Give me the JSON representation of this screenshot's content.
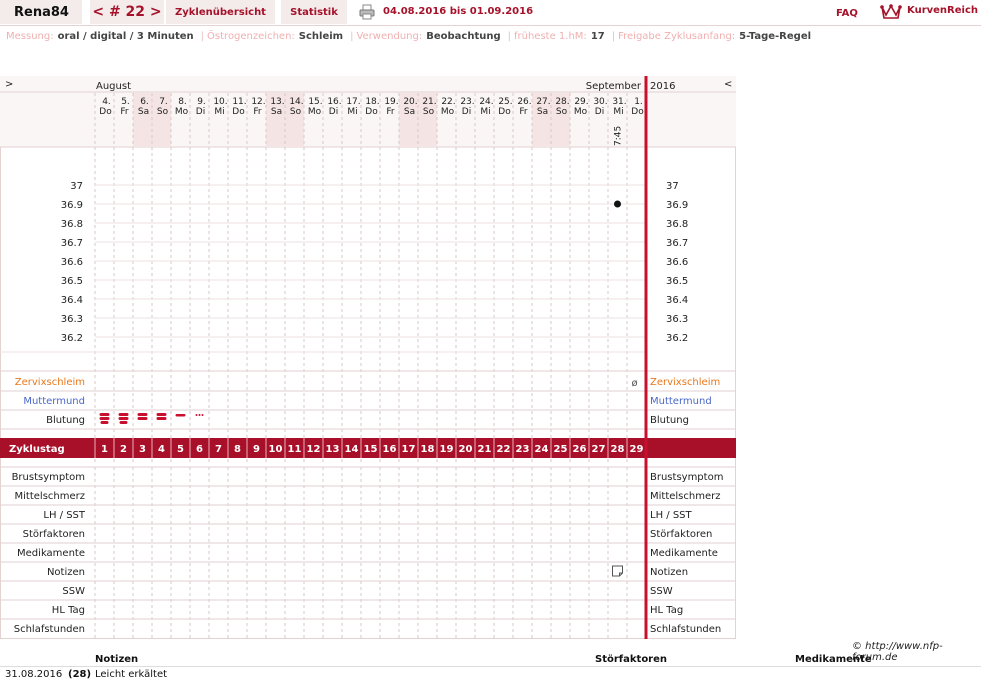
{
  "header": {
    "nickname": "Rena84",
    "cycle": "< # 22 >",
    "overview_tab": "Zyklenübersicht",
    "stats_tab": "Statistik",
    "date_range": "04.08.2016 bis 01.09.2016",
    "faq": "FAQ",
    "brand": "KurvenReich",
    "print_icon": "printer-icon",
    "logo_icon": "crown-icon"
  },
  "info": [
    {
      "label": "Messung:",
      "value": "oral / digital / 3 Minuten"
    },
    {
      "label": "Östrogenzeichen:",
      "value": "Schleim"
    },
    {
      "label": "Verwendung:",
      "value": "Beobachtung"
    },
    {
      "label": "früheste 1.hM:",
      "value": "17"
    },
    {
      "label": "Freigabe Zyklusanfang:",
      "value": "5-Tage-Regel"
    }
  ],
  "chart_data": {
    "type": "scatter",
    "nav_prev": ">",
    "nav_next": "<",
    "month_left": "August",
    "month_right": "September",
    "year": "2016",
    "dates": [
      "4.",
      "5.",
      "6.",
      "7.",
      "8.",
      "9.",
      "10.",
      "11.",
      "12.",
      "13.",
      "14.",
      "15.",
      "16.",
      "17.",
      "18.",
      "19.",
      "20.",
      "21.",
      "22.",
      "23.",
      "24.",
      "25.",
      "26.",
      "27.",
      "28.",
      "29.",
      "30.",
      "31.",
      "1."
    ],
    "weekdays": [
      "Do",
      "Fr",
      "Sa",
      "So",
      "Mo",
      "Di",
      "Mi",
      "Do",
      "Fr",
      "Sa",
      "So",
      "Mo",
      "Di",
      "Mi",
      "Do",
      "Fr",
      "Sa",
      "So",
      "Mo",
      "Di",
      "Mi",
      "Do",
      "Fr",
      "Sa",
      "So",
      "Mo",
      "Di",
      "Mi",
      "Do"
    ],
    "weekend_days": [
      3,
      4,
      10,
      11,
      17,
      18,
      24,
      25
    ],
    "time_labels": [
      {
        "day": 28,
        "text": "7:45"
      }
    ],
    "y_ticks": [
      "37",
      "36.9",
      "36.8",
      "36.7",
      "36.6",
      "36.5",
      "36.4",
      "36.3",
      "36.2"
    ],
    "ylim": [
      36.2,
      37.0
    ],
    "temperatures": [
      {
        "day": 28,
        "value": 36.9
      }
    ],
    "cycle_label": "Zyklustag",
    "cycle_days": [
      "1",
      "2",
      "3",
      "4",
      "5",
      "6",
      "7",
      "8",
      "9",
      "10",
      "11",
      "12",
      "13",
      "14",
      "15",
      "16",
      "17",
      "18",
      "19",
      "20",
      "21",
      "22",
      "23",
      "24",
      "25",
      "26",
      "27",
      "28",
      "29"
    ],
    "rows_upper": [
      {
        "label": "Zervixschleim",
        "color": "#e8771a"
      },
      {
        "label": "Muttermund",
        "color": "#4a67c9"
      },
      {
        "label": "Blutung",
        "color": "#222222"
      }
    ],
    "cervix_marks": [
      {
        "day": 29,
        "symbol": "ø"
      }
    ],
    "bleeding": [
      {
        "day": 1,
        "level": 3
      },
      {
        "day": 2,
        "level": 3
      },
      {
        "day": 3,
        "level": 2
      },
      {
        "day": 4,
        "level": 2
      },
      {
        "day": 5,
        "level": 1
      },
      {
        "day": 6,
        "level": 0
      }
    ],
    "rows_lower": [
      "Brustsymptom",
      "Mittelschmerz",
      "LH / SST",
      "Störfaktoren",
      "Medikamente",
      "Notizen",
      "SSW",
      "HL Tag",
      "Schlafstunden"
    ],
    "note_marks": [
      {
        "day": 28
      }
    ],
    "note_icon": "note-icon"
  },
  "footer": {
    "copyright": "© http://www.nfp-forum.de",
    "col_notes": "Notizen",
    "col_disturb": "Störfaktoren",
    "col_meds": "Medikamente",
    "rows": [
      {
        "date": "31.08.2016",
        "day": "(28)",
        "note": "Leicht erkältet"
      }
    ]
  }
}
